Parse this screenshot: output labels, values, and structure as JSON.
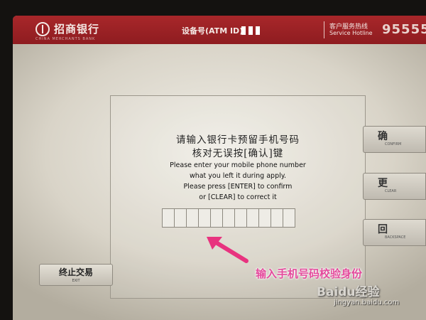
{
  "header": {
    "bank_name": "招商银行",
    "bank_sub": "CHINA MERCHANTS BANK",
    "device_label": "设备号(ATM ID)",
    "hotline_cn": "客户服务热线",
    "hotline_en": "Service Hotline",
    "hotline_number": "95555"
  },
  "prompt": {
    "cn_line1": "请输入银行卡预留手机号码",
    "cn_line2": "核对无误按[确认]键",
    "en_line1": "Please enter your mobile phone number",
    "en_line2": "what you left it during apply.",
    "en_line3": "Please press [ENTER] to confirm",
    "en_line4": "or [CLEAR] to correct it"
  },
  "input": {
    "digit_count": 11
  },
  "side_buttons": [
    {
      "cn": "确",
      "en": "CONFIRM"
    },
    {
      "cn": "更",
      "en": "CLEAR"
    },
    {
      "cn": "回",
      "en": "BACKSPACE"
    }
  ],
  "exit_button": {
    "cn": "终止交易",
    "en": "EXIT"
  },
  "annotation": {
    "caption": "输入手机号码校验身份",
    "watermark": "Baidu经验",
    "watermark_url": "jingyan.baidu.com",
    "caption_color": "#e44a9c",
    "arrow_color": "#e8337f"
  },
  "colors": {
    "header_red": "#9b2226"
  }
}
